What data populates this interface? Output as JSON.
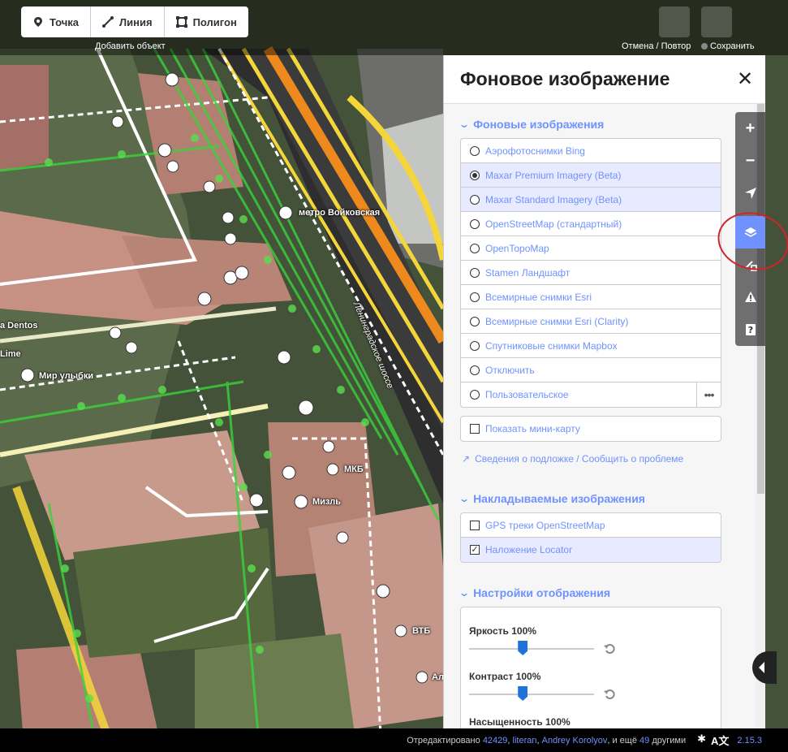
{
  "toolbar": {
    "modes": [
      {
        "label": "Точка",
        "icon": "point-icon"
      },
      {
        "label": "Линия",
        "icon": "line-icon"
      },
      {
        "label": "Полигон",
        "icon": "polygon-icon"
      }
    ],
    "add_hint": "Добавить объект",
    "undo_redo": "Отмена / Повтор",
    "save": "Сохранить"
  },
  "map": {
    "labels": {
      "metro": "метро Войковская",
      "dentos": "a Dentos",
      "lime": "Lime",
      "smile": "Мир улыбки",
      "street": "Ленинградское шоссе",
      "mkb": "МКБ",
      "mizl": "Мизль",
      "vtb": "ВТБ",
      "al": "Ал"
    }
  },
  "pane": {
    "title": "Фоновое изображение",
    "close_icon": "close-icon",
    "background_section": {
      "title": "Фоновые изображения",
      "items": [
        {
          "label": "Аэрофотоснимки Bing",
          "selected": false
        },
        {
          "label": "Maxar Premium Imagery (Beta)",
          "selected": true
        },
        {
          "label": "Maxar Standard Imagery (Beta)",
          "selected": false
        },
        {
          "label": "OpenStreetMap (стандартный)",
          "selected": false
        },
        {
          "label": "OpenTopoMap",
          "selected": false
        },
        {
          "label": "Stamen Ландшафт",
          "selected": false
        },
        {
          "label": "Всемирные снимки Esri",
          "selected": false
        },
        {
          "label": "Всемирные снимки Esri (Clarity)",
          "selected": false
        },
        {
          "label": "Спутниковые снимки Mapbox",
          "selected": false
        },
        {
          "label": "Отключить",
          "selected": false
        },
        {
          "label": "Пользовательское",
          "selected": false
        }
      ],
      "minimap_label": "Показать мини-карту",
      "info_link": "Сведения о подложке / Сообщить о проблеме"
    },
    "overlay_section": {
      "title": "Накладываемые изображения",
      "items": [
        {
          "label": "GPS треки OpenStreetMap",
          "checked": false
        },
        {
          "label": "Наложение Locator",
          "checked": true
        }
      ]
    },
    "display_section": {
      "title": "Настройки отображения",
      "brightness": {
        "label": "Яркость",
        "value": "100%",
        "level": 0.43
      },
      "contrast": {
        "label": "Контраст",
        "value": "100%",
        "level": 0.43
      },
      "saturation": {
        "label": "Насыщенность",
        "value": "100%"
      }
    }
  },
  "controls": [
    "zoom-in-icon",
    "zoom-out-icon",
    "geolocate-icon",
    "layers-icon",
    "map-data-icon",
    "issues-icon",
    "help-icon"
  ],
  "footer": {
    "prefix": "Отредактировано",
    "user1": "42429",
    "sep1": ",",
    "user2": "literan",
    "sep2": ",",
    "user3": "Andrey Korolyov",
    "middle": ", и ещё",
    "count": "49",
    "suffix": "другими",
    "version": "2.15.3",
    "lang_icon": "A文"
  }
}
